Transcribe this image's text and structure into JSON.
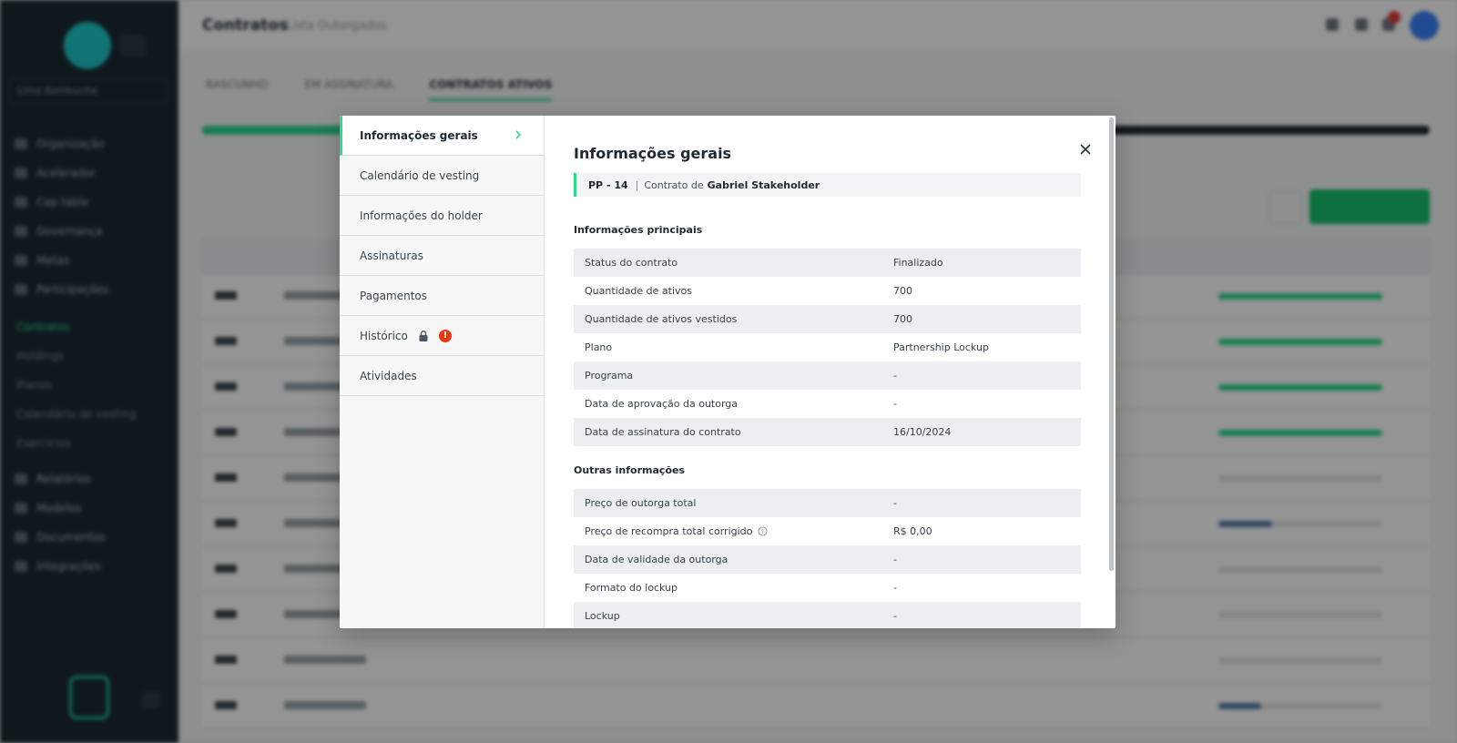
{
  "background": {
    "header": {
      "title": "Contratos",
      "subtitle": "Lista Outorgados"
    },
    "tabs": [
      "RASCUNHO",
      "EM ASSINATURA",
      "CONTRATOS ATIVOS"
    ],
    "sidebar": {
      "select": "Lima Kombucha",
      "items": [
        "Organização",
        "Acelerador",
        "Cap table",
        "Governança",
        "Metas",
        "Participações"
      ],
      "subitems": [
        "Contratos",
        "Holdings",
        "Planos",
        "Calendário de vesting",
        "Exercícios"
      ],
      "items_bottom": [
        "Relatórios",
        "Modelos",
        "Documentos",
        "Integrações"
      ]
    }
  },
  "modal": {
    "nav": [
      {
        "label": "Informações gerais",
        "active": true
      },
      {
        "label": "Calendário de vesting"
      },
      {
        "label": "Informações do holder"
      },
      {
        "label": "Assinaturas"
      },
      {
        "label": "Pagamentos"
      },
      {
        "label": "Histórico",
        "locked": true,
        "warning": "!"
      },
      {
        "label": "Atividades"
      }
    ],
    "title": "Informações gerais",
    "contract": {
      "code": "PP - 14",
      "separator": "|",
      "prefix": "Contrato de",
      "holder": "Gabriel Stakeholder"
    },
    "main_section": {
      "title": "Informações principais",
      "rows": [
        {
          "label": "Status do contrato",
          "value": "Finalizado"
        },
        {
          "label": "Quantidade de ativos",
          "value": "700"
        },
        {
          "label": "Quantidade de ativos vestidos",
          "value": "700"
        },
        {
          "label": "Plano",
          "value": "Partnership Lockup"
        },
        {
          "label": "Programa",
          "value": "-"
        },
        {
          "label": "Data de aprovação da outorga",
          "value": "-"
        },
        {
          "label": "Data de assinatura do contrato",
          "value": "16/10/2024"
        }
      ]
    },
    "other_section": {
      "title": "Outras informações",
      "rows": [
        {
          "label": "Preço de outorga total",
          "value": "-"
        },
        {
          "label": "Preço de recompra total corrigido",
          "value": "R$ 0,00",
          "help": true
        },
        {
          "label": "Data de validade da outorga",
          "value": "-"
        },
        {
          "label": "Formato do lockup",
          "value": "-"
        },
        {
          "label": "Lockup",
          "value": "-"
        }
      ]
    }
  },
  "colors": {
    "accent": "#2fd98f",
    "warning": "#e8380d",
    "sidebar": "#1b2b33"
  }
}
